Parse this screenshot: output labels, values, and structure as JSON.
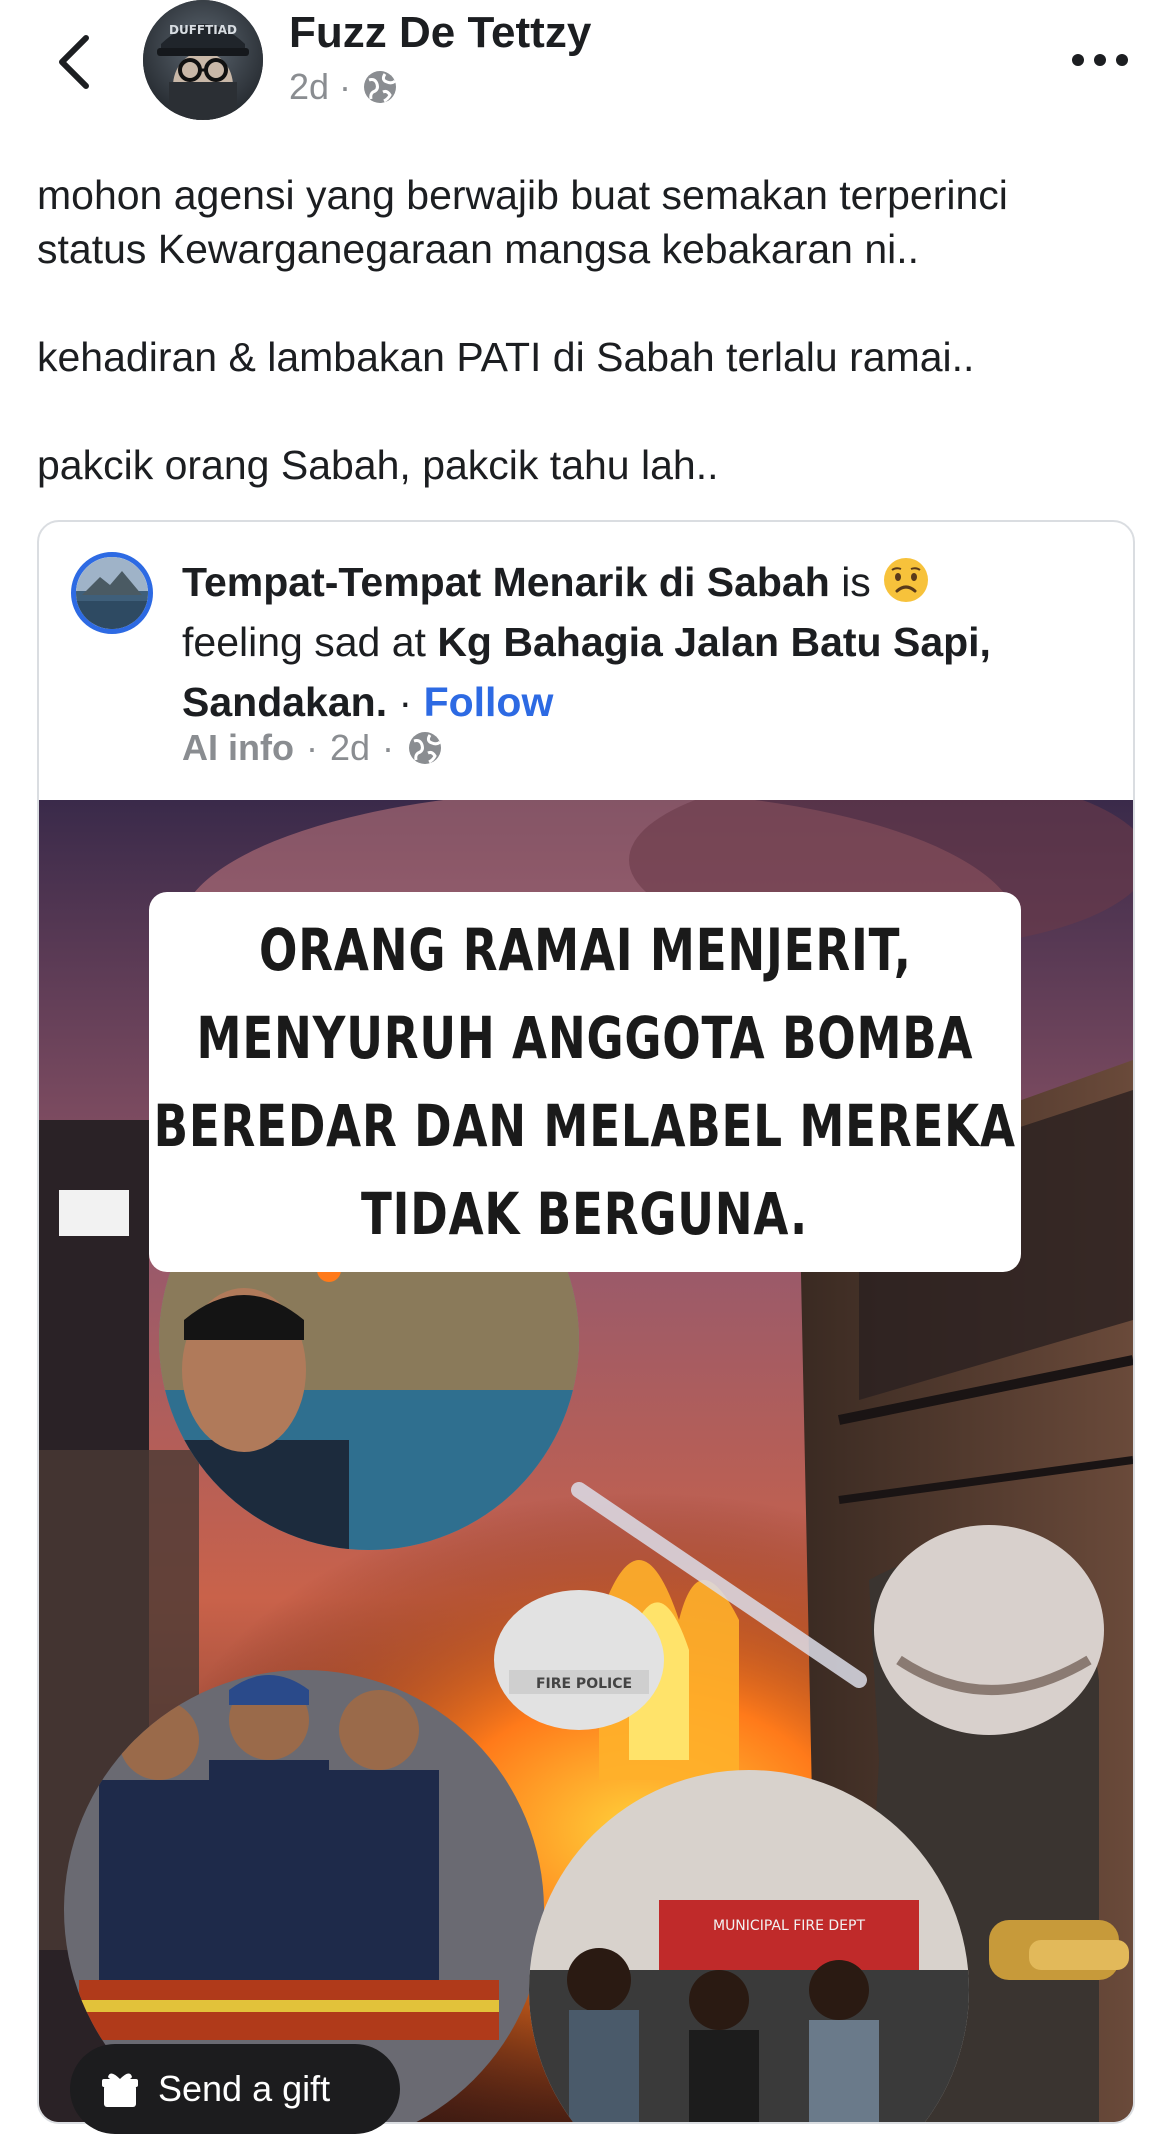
{
  "header": {
    "author_name": "Fuzz De Tettzy",
    "time": "2d",
    "separator": "·",
    "privacy_icon": "globe-icon",
    "back_icon": "chevron-left-icon",
    "more_icon": "more-horizontal-icon",
    "avatar_text": "DUFFTIAD"
  },
  "post": {
    "lines": [
      "mohon agensi yang berwajib buat semakan terperinci",
      "status Kewarganegaraan mangsa kebakaran ni..",
      "kehadiran & lambakan PATI di Sabah terlalu ramai..",
      "pakcik orang Sabah, pakcik tahu lah.."
    ]
  },
  "shared": {
    "page_name": "Tempat-Tempat Menarik di Sabah",
    "is": "is",
    "feeling": "feeling sad at",
    "location": "Kg Bahagia Jalan Batu Sapi, Sandakan.",
    "dot": "·",
    "follow": "Follow",
    "ai_info": "AI info",
    "time": "2d",
    "privacy_icon": "globe-icon",
    "emoji_icon": "sad-face-icon"
  },
  "image": {
    "headline": [
      "ORANG RAMAI MENJERIT,",
      "MENYURUH ANGGOTA BOMBA",
      "BEREDAR DAN MELABEL MEREKA",
      "TIDAK BERGUNA."
    ],
    "helmet_text": "FIRE POLICE",
    "truck_text": "MUNICIPAL FIRE DEPT"
  },
  "gift": {
    "label": "Send a gift",
    "icon": "gift-icon"
  },
  "colors": {
    "link": "#2d6ae3",
    "text": "#1c1e21",
    "muted": "#8a8d91",
    "border": "#dadde1"
  }
}
